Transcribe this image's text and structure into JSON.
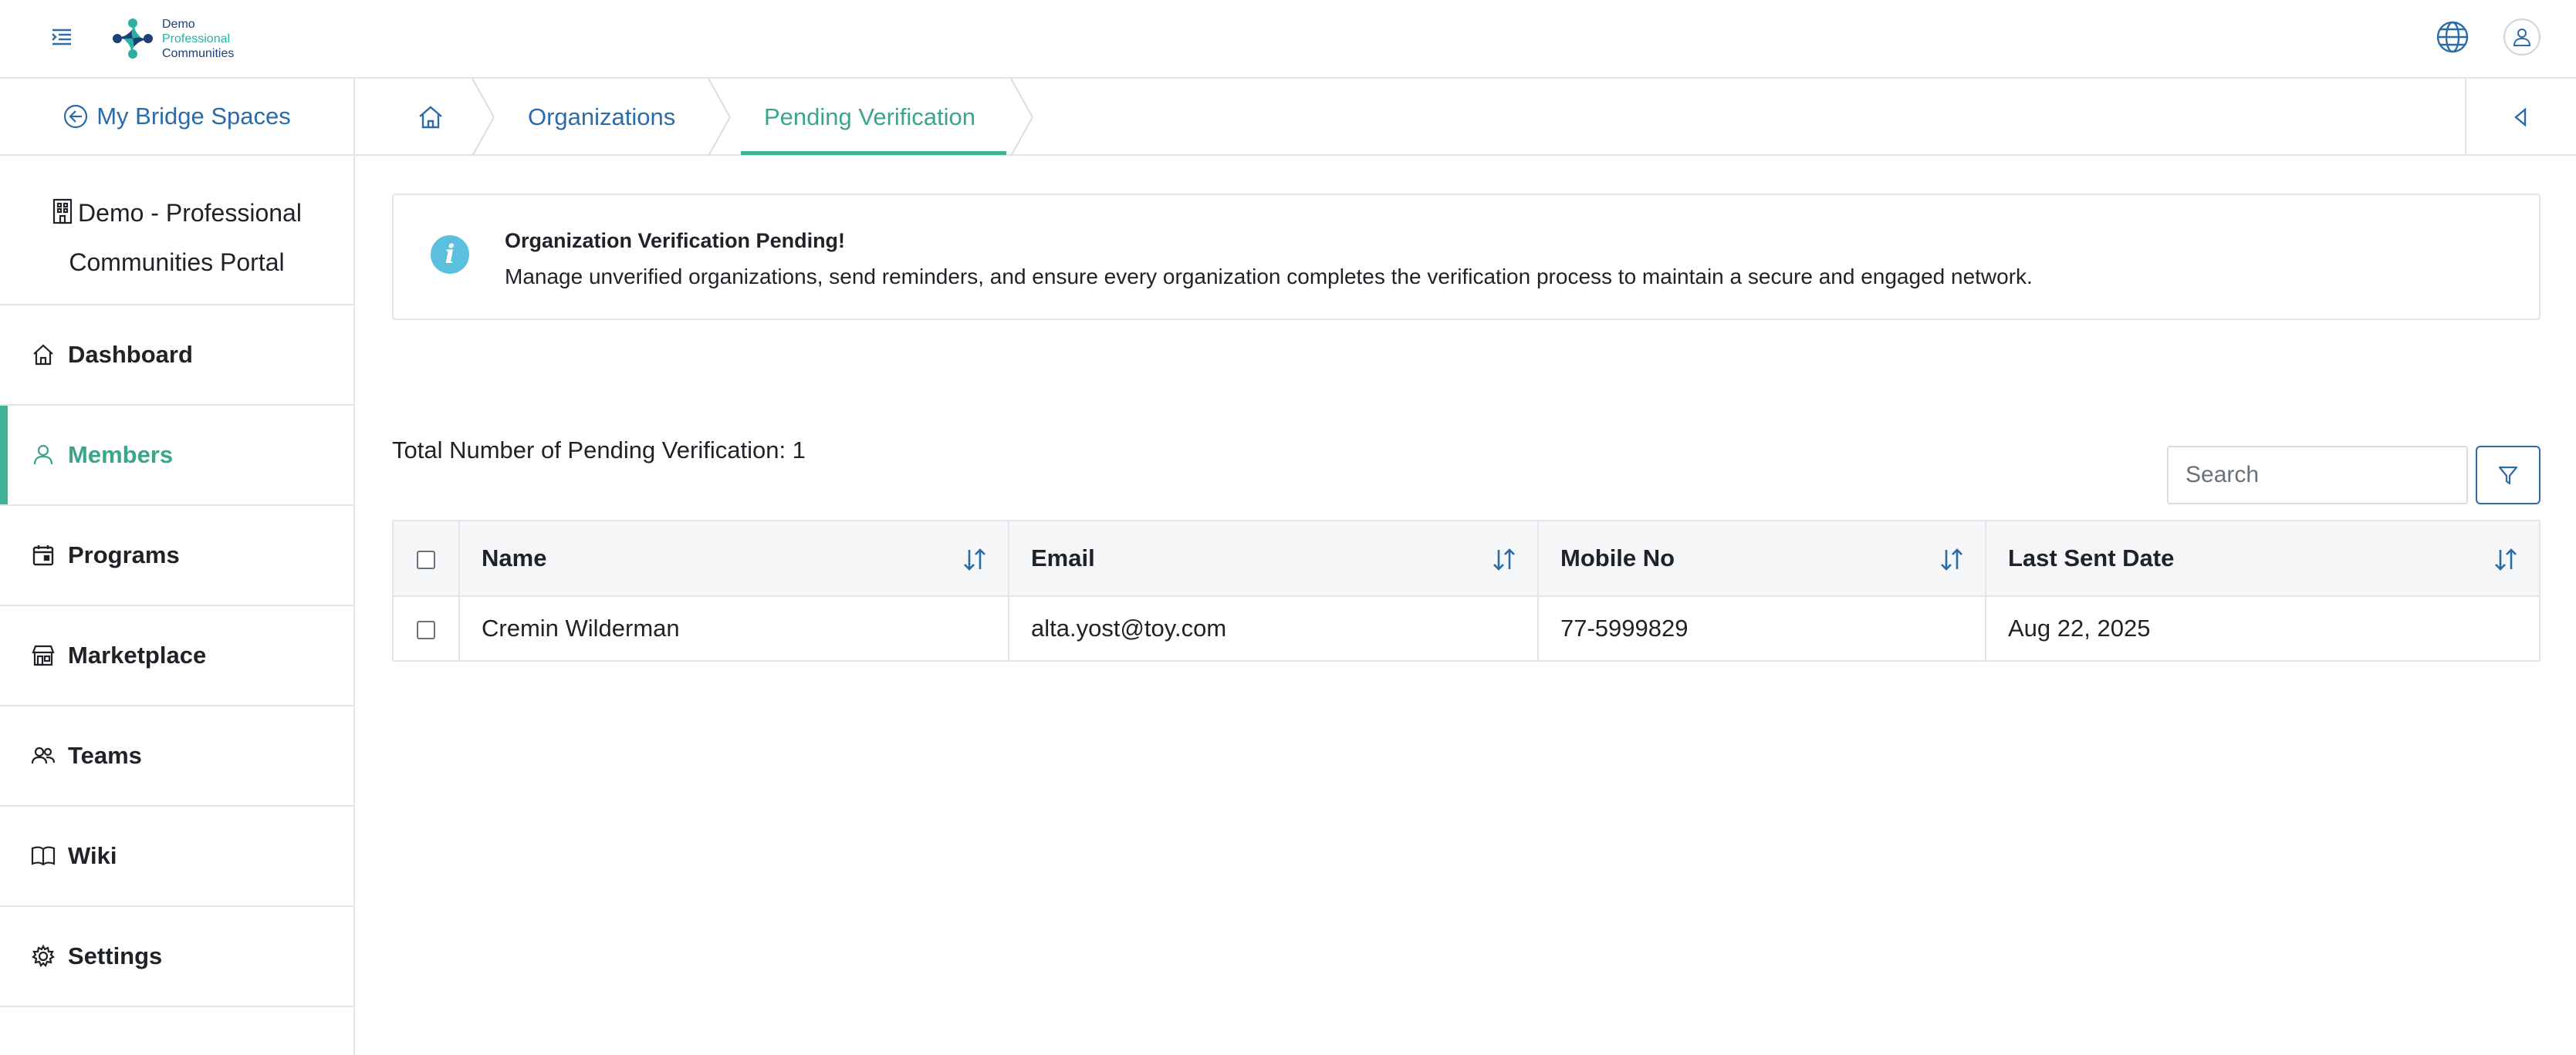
{
  "header": {
    "logo_lines": [
      "Demo",
      "Professional",
      "Communities"
    ],
    "icons": {
      "menu": "menu-icon",
      "language": "globe-icon",
      "profile": "user-icon"
    }
  },
  "sidebar": {
    "back_label": "My Bridge Spaces",
    "portal_name": "Demo - Professional Communities Portal",
    "items": [
      {
        "label": "Dashboard",
        "icon": "home-icon",
        "active": false
      },
      {
        "label": "Members",
        "icon": "user-icon",
        "active": true
      },
      {
        "label": "Programs",
        "icon": "calendar-icon",
        "active": false
      },
      {
        "label": "Marketplace",
        "icon": "store-icon",
        "active": false
      },
      {
        "label": "Teams",
        "icon": "users-icon",
        "active": false
      },
      {
        "label": "Wiki",
        "icon": "book-icon",
        "active": false
      },
      {
        "label": "Settings",
        "icon": "gear-icon",
        "active": false
      }
    ]
  },
  "breadcrumb": {
    "items": [
      "Organizations",
      "Pending Verification"
    ]
  },
  "banner": {
    "title": "Organization Verification Pending!",
    "text": "Manage unverified organizations, send reminders, and ensure every organization completes the verification process to maintain a secure and engaged network."
  },
  "summary": {
    "total_label": "Total Number of Pending Verification: 1"
  },
  "search": {
    "placeholder": "Search",
    "value": ""
  },
  "table": {
    "columns": [
      "Name",
      "Email",
      "Mobile No",
      "Last Sent Date"
    ],
    "rows": [
      {
        "name": "Cremin Wilderman",
        "email": "alta.yost@toy.com",
        "mobile": "77-5999829",
        "last_sent": "Aug 22, 2025"
      }
    ]
  },
  "colors": {
    "accent": "#3fb394",
    "link": "#2b6ca8",
    "info": "#5bc0de"
  }
}
